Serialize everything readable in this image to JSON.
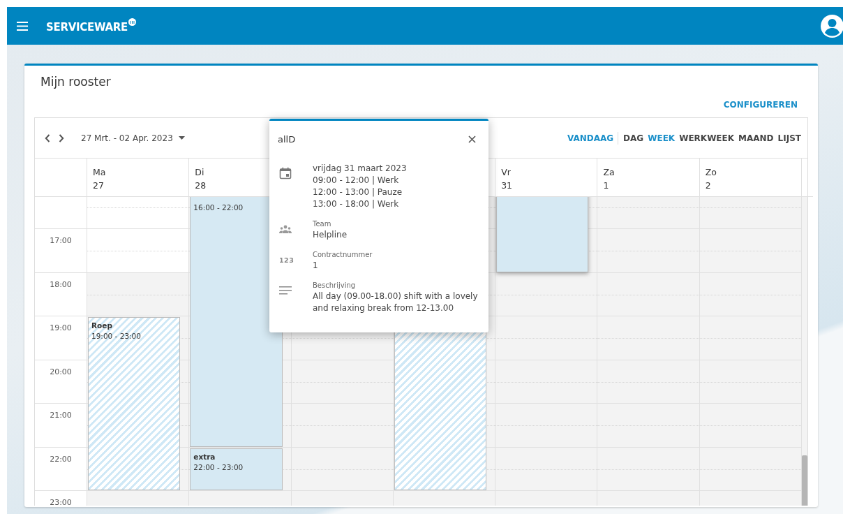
{
  "app_bar": {
    "logo": "SERVICEWARE"
  },
  "page": {
    "title": "Mijn rooster",
    "configure_link": "CONFIGUREREN"
  },
  "toolbar": {
    "date_range": "27 Mrt. - 02 Apr. 2023",
    "today": "VANDAAG",
    "views": [
      {
        "label": "DAG",
        "selected": false
      },
      {
        "label": "WEEK",
        "selected": true
      },
      {
        "label": "WERKWEEK",
        "selected": false
      },
      {
        "label": "MAAND",
        "selected": false
      },
      {
        "label": "LIJST",
        "selected": false
      }
    ]
  },
  "days": [
    {
      "name": "Ma",
      "date": "27",
      "highlighted": true
    },
    {
      "name": "Di",
      "date": "28",
      "highlighted": false
    },
    {
      "name": "Vr",
      "date": "31",
      "highlighted": false
    },
    {
      "name": "Za",
      "date": "1",
      "highlighted": false
    },
    {
      "name": "Zo",
      "date": "2",
      "highlighted": false
    }
  ],
  "hours": [
    "17:00",
    "18:00",
    "19:00",
    "20:00",
    "21:00",
    "22:00",
    "23:00"
  ],
  "events": [
    {
      "kind": "hatched",
      "title": "Roep",
      "time": "19:00 - 23:00",
      "selected": false
    },
    {
      "kind": "solid",
      "time": "16:00 - 22:00",
      "selected": false
    },
    {
      "kind": "solid",
      "title": "extra",
      "time": "22:00 - 23:00",
      "selected": false
    },
    {
      "kind": "hatched",
      "selected": false
    },
    {
      "kind": "solid",
      "selected": true
    }
  ],
  "popup": {
    "title": "allD",
    "sections": [
      {
        "kind": "calendar",
        "lines": [
          "vrijdag 31 maart 2023",
          "09:00 - 12:00 | Werk",
          "12:00 - 13:00 | Pauze",
          "13:00 - 18:00 | Werk"
        ]
      },
      {
        "kind": "team",
        "label": "Team",
        "lines": [
          "Helpline"
        ]
      },
      {
        "kind": "number",
        "icon_text": "123",
        "label": "Contractnummer",
        "lines": [
          "1"
        ]
      },
      {
        "kind": "notes",
        "label": "Beschrijving",
        "lines": [
          "All day (09.00-18.00) shift with a lovely and relaxing break from 12-13.00"
        ]
      }
    ]
  }
}
